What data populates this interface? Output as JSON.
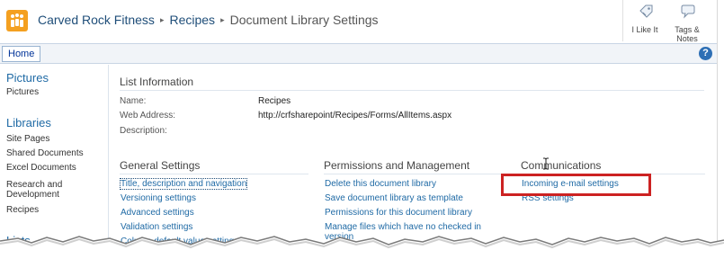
{
  "breadcrumb": {
    "site": "Carved Rock Fitness",
    "list": "Recipes",
    "current": "Document Library Settings",
    "separator": "▸"
  },
  "social": {
    "like_label": "I Like It",
    "tags_label_1": "Tags &",
    "tags_label_2": "Notes"
  },
  "ribbon": {
    "home_tab": "Home",
    "help": "?"
  },
  "leftnav": {
    "pictures_head": "Pictures",
    "pictures_item": "Pictures",
    "libraries_head": "Libraries",
    "libraries_items": [
      "Site Pages",
      "Shared Documents",
      "Excel Documents",
      "Research and Development",
      "Recipes"
    ],
    "lists_head": "Lists"
  },
  "list_info": {
    "heading": "List Information",
    "name_label": "Name:",
    "name_value": "Recipes",
    "web_label": "Web Address:",
    "web_value": "http://crfsharepoint/Recipes/Forms/AllItems.aspx",
    "desc_label": "Description:"
  },
  "general": {
    "heading": "General Settings",
    "links": [
      "Title, description and navigation",
      "Versioning settings",
      "Advanced settings",
      "Validation settings",
      "Column default value settings"
    ]
  },
  "permissions": {
    "heading": "Permissions and Management",
    "links": [
      "Delete this document library",
      "Save document library as template",
      "Permissions for this document library",
      "Manage files which have no checked in version"
    ]
  },
  "communications": {
    "heading": "Communications",
    "links": [
      "Incoming e-mail settings",
      "RSS settings"
    ]
  },
  "colors": {
    "link": "#1f6aa5",
    "highlight": "#cc2222",
    "logo": "#f4a020"
  }
}
